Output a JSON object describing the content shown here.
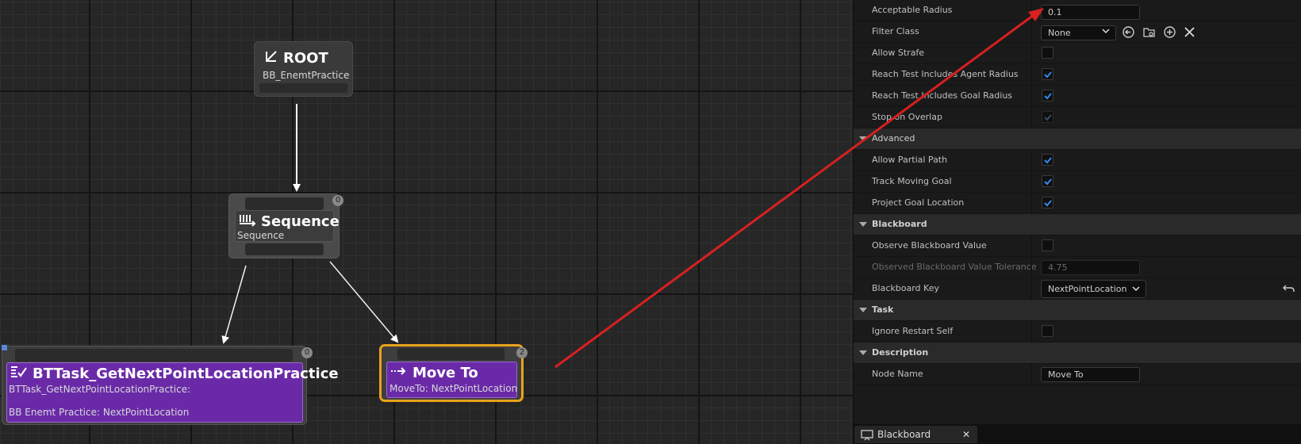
{
  "graph": {
    "root": {
      "title": "ROOT",
      "subtitle": "BB_EnemtPractice"
    },
    "sequence": {
      "title": "Sequence",
      "subtitle": "Sequence",
      "badge": "0"
    },
    "task": {
      "title": "BTTask_GetNextPointLocationPractice",
      "line1": "BTTask_GetNextPointLocationPractice:",
      "line2": "BB Enemt Practice: NextPointLocation",
      "badge": "0"
    },
    "moveto": {
      "title": "Move To",
      "subtitle": "MoveTo: NextPointLocation",
      "badge": "2"
    }
  },
  "details": {
    "acceptable_radius": {
      "label": "Acceptable Radius",
      "value": "0.1"
    },
    "filter_class": {
      "label": "Filter Class",
      "value": "None"
    },
    "allow_strafe": {
      "label": "Allow Strafe",
      "checked": false
    },
    "reach_agent": {
      "label": "Reach Test Includes Agent Radius",
      "checked": true
    },
    "reach_goal": {
      "label": "Reach Test Includes Goal Radius",
      "checked": true
    },
    "stop_overlap": {
      "label": "Stop on Overlap",
      "checked": true
    },
    "advanced_section": "Advanced",
    "allow_partial": {
      "label": "Allow Partial Path",
      "checked": true
    },
    "track_moving": {
      "label": "Track Moving Goal",
      "checked": true
    },
    "project_goal": {
      "label": "Project Goal Location",
      "checked": true
    },
    "blackboard_section": "Blackboard",
    "observe_bb": {
      "label": "Observe Blackboard Value",
      "checked": false
    },
    "observed_tol": {
      "label": "Observed Blackboard Value Tolerance",
      "value": "4.75"
    },
    "bb_key": {
      "label": "Blackboard Key",
      "value": "NextPointLocation"
    },
    "task_section": "Task",
    "ignore_restart": {
      "label": "Ignore Restart Self",
      "checked": false
    },
    "description_section": "Description",
    "node_name": {
      "label": "Node Name",
      "value": "Move To"
    }
  },
  "bottom_tab": {
    "label": "Blackboard"
  },
  "colors": {
    "accent": "#0070e0",
    "task_purple": "#6a2aa8",
    "selection": "#e8a31b",
    "arrow": "#d82020"
  }
}
